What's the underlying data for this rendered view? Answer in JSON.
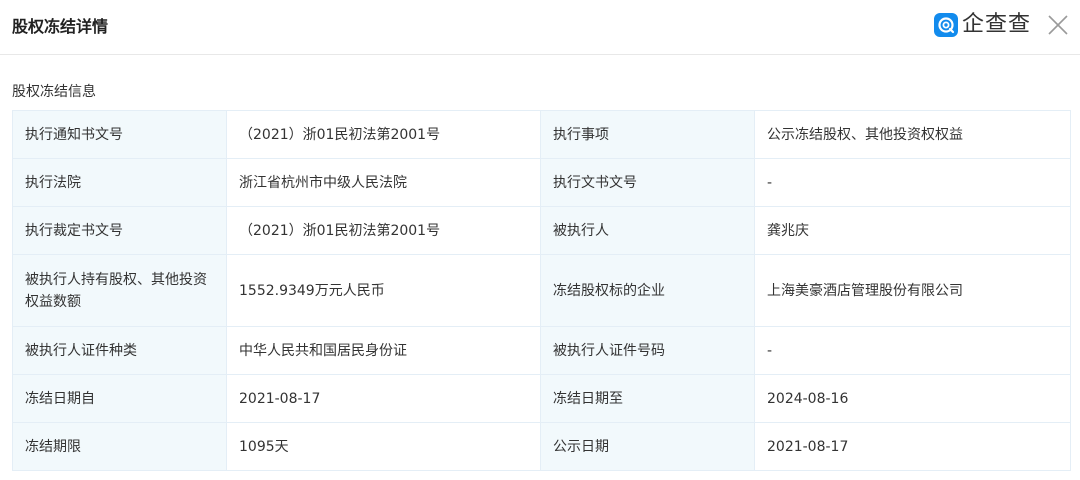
{
  "header": {
    "title": "股权冻结详情",
    "brand_text": "企查查",
    "brand_color": "#128bed",
    "brand_icon": "qichacha-logo-icon",
    "close_icon": "close-icon"
  },
  "section": {
    "title": "股权冻结信息"
  },
  "rows": [
    {
      "l1": "执行通知书文号",
      "v1": "（2021）浙01民初法第2001号",
      "l2": "执行事项",
      "v2": "公示冻结股权、其他投资权权益"
    },
    {
      "l1": "执行法院",
      "v1": "浙江省杭州市中级人民法院",
      "l2": "执行文书文号",
      "v2": "-"
    },
    {
      "l1": "执行裁定书文号",
      "v1": "（2021）浙01民初法第2001号",
      "l2": "被执行人",
      "v2": "龚兆庆"
    },
    {
      "l1": "被执行人持有股权、其他投资权益数额",
      "v1": "1552.9349万元人民币",
      "l2": "冻结股权标的企业",
      "v2": "上海美豪酒店管理股份有限公司"
    },
    {
      "l1": "被执行人证件种类",
      "v1": "中华人民共和国居民身份证",
      "l2": "被执行人证件号码",
      "v2": "-"
    },
    {
      "l1": "冻结日期自",
      "v1": "2021-08-17",
      "l2": "冻结日期至",
      "v2": "2024-08-16"
    },
    {
      "l1": "冻结期限",
      "v1": "1095天",
      "l2": "公示日期",
      "v2": "2021-08-17"
    }
  ],
  "colors": {
    "link": "#128bed",
    "label_bg": "#f2f9fc",
    "border": "#e4eef6"
  }
}
